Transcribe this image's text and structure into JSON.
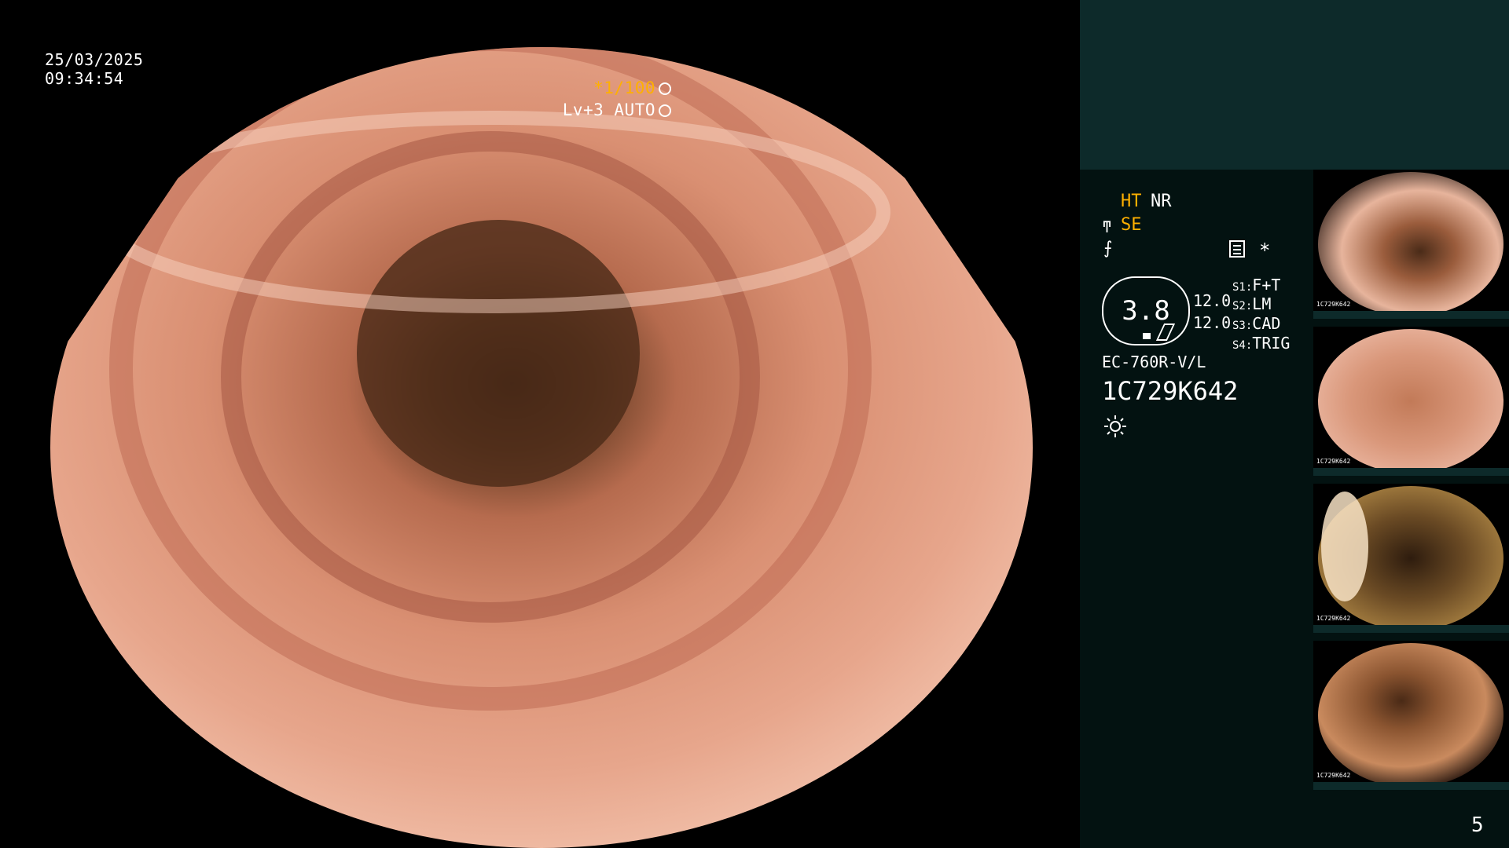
{
  "overlay": {
    "date": "25/03/2025",
    "time": "09:34:54",
    "shutter": "*1/100",
    "level": "Lv+3 AUTO"
  },
  "panel": {
    "ht": "HT",
    "nr": "NR",
    "se": "SE",
    "gauge_value": "3.8",
    "num1": "12.0",
    "num2": "12.0",
    "s1": {
      "label": "S1:",
      "value": "F+T"
    },
    "s2": {
      "label": "S2:",
      "value": "LM"
    },
    "s3": {
      "label": "S3:",
      "value": "CAD"
    },
    "s4": {
      "label": "S4:",
      "value": "TRIG"
    },
    "model": "EC-760R-V/L",
    "serial": "1C729K642",
    "star": "*",
    "page_number": "5"
  },
  "thumbnails": [
    {
      "label": "1C729K642"
    },
    {
      "label": "1C729K642"
    },
    {
      "label": "1C729K642"
    },
    {
      "label": "1C729K642"
    }
  ],
  "colors": {
    "accent": "#ffb000",
    "panel_bg": "#031211",
    "panel_top": "#0d2a2a"
  }
}
